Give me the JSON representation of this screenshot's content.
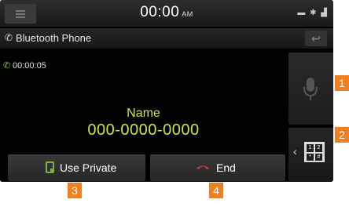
{
  "status_bar": {
    "time": "00:00",
    "ampm": "AM",
    "icons": [
      "battery-icon",
      "bluetooth-icon",
      "signal-icon"
    ]
  },
  "header": {
    "title": "Bluetooth Phone",
    "title_icon": "phone-icon",
    "back_icon": "back-arrow-icon"
  },
  "call": {
    "duration": "00:00:05",
    "duration_icon": "call-active-icon",
    "name": "Name",
    "number": "000-0000-0000"
  },
  "side_buttons": [
    {
      "icon": "microphone-icon"
    },
    {
      "icon": "keypad-icon",
      "keys": [
        "1",
        "2",
        "*",
        "#"
      ]
    }
  ],
  "bottom_buttons": {
    "use_private": "Use Private",
    "end": "End"
  },
  "callouts": [
    "1",
    "2",
    "3",
    "4"
  ],
  "colors": {
    "accent_text": "#c8e64a",
    "callout": "#f07f22",
    "end_icon": "#e53935",
    "private_icon": "#7cb342"
  }
}
